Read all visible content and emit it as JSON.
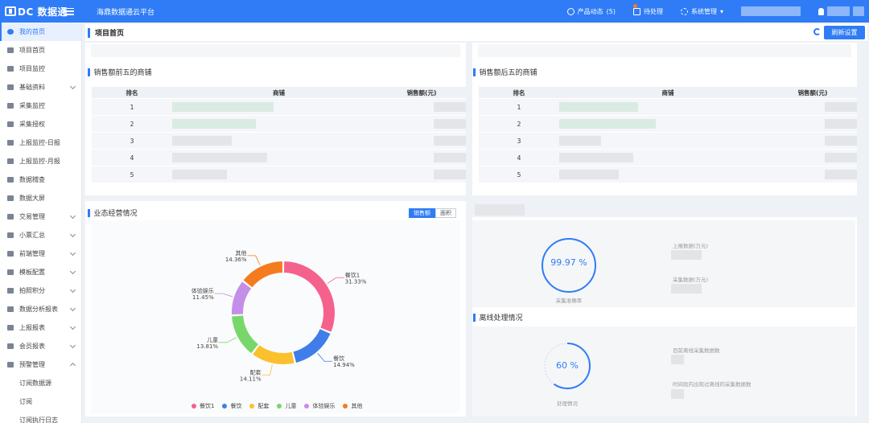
{
  "app": {
    "logo": "DC 数据通",
    "platform": "海鼎数据通云平台"
  },
  "topbar": {
    "product_news": "产品动态",
    "product_news_count": "(5)",
    "todo": "待处理",
    "system": "系统管理"
  },
  "sidebar": {
    "items": [
      {
        "label": "我的首页",
        "icon": "eye-icon",
        "active": true
      },
      {
        "label": "项目首页",
        "icon": "home-icon"
      },
      {
        "label": "项目监控",
        "icon": "monitor-icon"
      },
      {
        "label": "基础资料",
        "icon": "database-icon",
        "expandable": true
      },
      {
        "label": "采集监控",
        "icon": "monitor-icon"
      },
      {
        "label": "采集授权",
        "icon": "gear-icon"
      },
      {
        "label": "上报监控-日报",
        "icon": "gear-icon"
      },
      {
        "label": "上报监控-月报",
        "icon": "gear-icon"
      },
      {
        "label": "数据稽查",
        "icon": "half-circle-icon"
      },
      {
        "label": "数据大屏",
        "icon": "bar-chart-icon"
      },
      {
        "label": "交易管理",
        "icon": "card-icon",
        "expandable": true
      },
      {
        "label": "小票汇总",
        "icon": "bell-icon",
        "expandable": true
      },
      {
        "label": "前端管理",
        "icon": "gear-icon",
        "expandable": true
      },
      {
        "label": "模板配置",
        "icon": "template-icon",
        "expandable": true
      },
      {
        "label": "拍照积分",
        "icon": "gear-icon",
        "expandable": true
      },
      {
        "label": "数据分析报表",
        "icon": "bar-chart-icon",
        "expandable": true
      },
      {
        "label": "上报报表",
        "icon": "gear-icon",
        "expandable": true
      },
      {
        "label": "会员报表",
        "icon": "gear-icon",
        "expandable": true
      },
      {
        "label": "预警管理",
        "icon": "bookmark-icon",
        "expanded": true
      },
      {
        "label": "订阅数据源",
        "sub": true
      },
      {
        "label": "订阅",
        "sub": true
      },
      {
        "label": "订阅执行日志",
        "sub": true
      }
    ]
  },
  "header": {
    "title": "项目首页",
    "refresh_label": "刷新设置"
  },
  "top5": {
    "title": "销售额前五的商铺",
    "columns": [
      "排名",
      "商铺",
      "销售额(元)"
    ],
    "ranks": [
      "1",
      "2",
      "3",
      "4",
      "5"
    ]
  },
  "bottom5": {
    "title": "销售额后五的商铺",
    "columns": [
      "排名",
      "商铺",
      "销售额(元)"
    ],
    "ranks": [
      "1",
      "2",
      "3",
      "4",
      "5"
    ]
  },
  "business": {
    "title": "业态经营情况",
    "tabs": [
      "销售额",
      "面积"
    ],
    "active_tab": "销售额"
  },
  "chart_data": {
    "type": "pie",
    "donut": true,
    "categories": [
      "餐饮1",
      "餐饮",
      "配套",
      "儿童",
      "体验娱乐",
      "其他"
    ],
    "values": [
      31.33,
      14.94,
      14.11,
      13.81,
      11.45,
      14.36
    ],
    "labels": [
      "31.33%",
      "14.94%",
      "14.11%",
      "13.81%",
      "11.45%",
      "14.36%"
    ],
    "colors": [
      "#f5618d",
      "#3f7ee8",
      "#fbc02d",
      "#77d76a",
      "#c58ee8",
      "#f47c1e"
    ],
    "legend_position": "bottom"
  },
  "collection": {
    "rate": "99.97 %",
    "rate_value": 99.97,
    "caption": "采集准确率",
    "report_label": "上报数据(万元)",
    "collect_label": "采集数据(万元)"
  },
  "offline": {
    "title": "离线处理情况",
    "rate": "60 %",
    "rate_value": 60,
    "caption": "处理情况",
    "label1": "目前离线采集数据数",
    "label2": "时间段内出现过离线的采集数据数"
  },
  "colors": {
    "primary": "#2f7cf6"
  }
}
